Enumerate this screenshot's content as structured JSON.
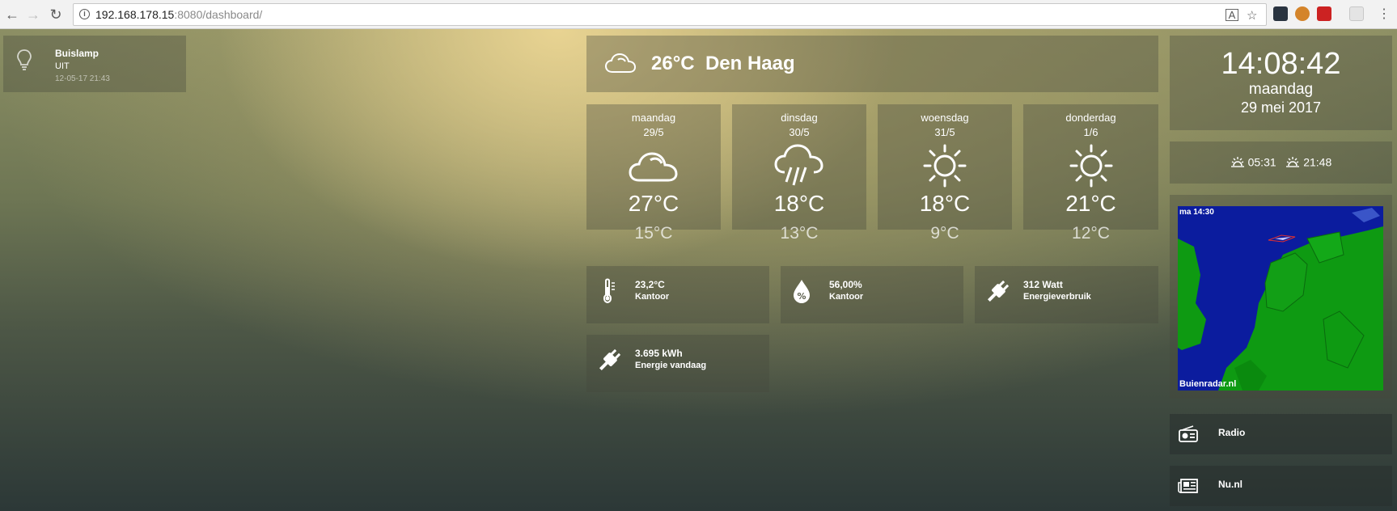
{
  "browser": {
    "url_host": "192.168.178.15",
    "url_rest": ":8080/dashboard/"
  },
  "lamp": {
    "title": "Buislamp",
    "state": "UIT",
    "timestamp": "12-05-17 21:43"
  },
  "current_weather": {
    "temperature": "26°C",
    "city": "Den Haag",
    "icon": "cloud-icon"
  },
  "forecast": [
    {
      "day": "maandag",
      "date": "29/5",
      "high": "27°C",
      "low": "15°C",
      "icon": "cloud-icon"
    },
    {
      "day": "dinsdag",
      "date": "30/5",
      "high": "18°C",
      "low": "13°C",
      "icon": "cloud-rain-icon"
    },
    {
      "day": "woensdag",
      "date": "31/5",
      "high": "18°C",
      "low": "9°C",
      "icon": "sun-icon"
    },
    {
      "day": "donderdag",
      "date": "1/6",
      "high": "21°C",
      "low": "12°C",
      "icon": "sun-icon"
    }
  ],
  "sensors": [
    {
      "value": "23,2°C",
      "label": "Kantoor",
      "icon": "thermometer-icon"
    },
    {
      "value": "56,00%",
      "label": "Kantoor",
      "icon": "humidity-icon"
    },
    {
      "value": "312 Watt",
      "label": "Energieverbruik",
      "icon": "plug-icon"
    },
    {
      "value": "3.695 kWh",
      "label": "Energie vandaag",
      "icon": "plug-icon"
    }
  ],
  "clock": {
    "time": "14:08:42",
    "day": "maandag",
    "date": "29 mei 2017"
  },
  "sun": {
    "sunrise": "05:31",
    "sunset": "21:48"
  },
  "radar": {
    "time": "ma 14:30",
    "brand": "Buienradar.nl"
  },
  "links": [
    {
      "label": "Radio",
      "icon": "radio-icon"
    },
    {
      "label": "Nu.nl",
      "icon": "newspaper-icon"
    }
  ]
}
